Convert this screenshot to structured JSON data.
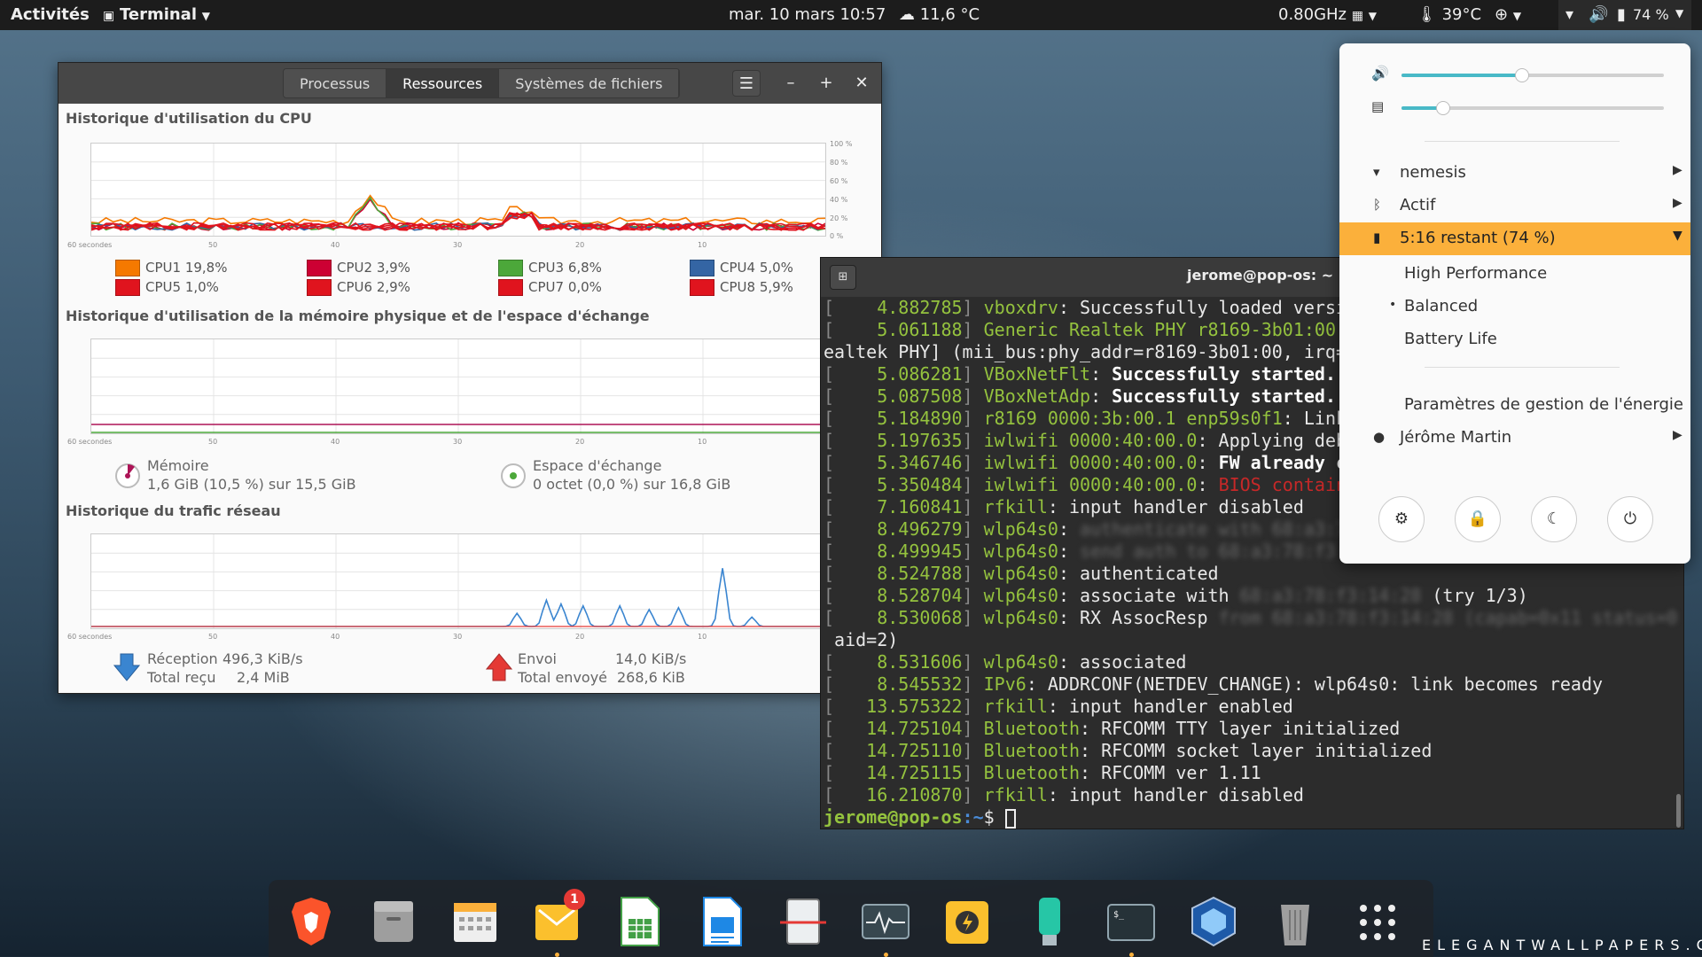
{
  "topbar": {
    "activities": "Activités",
    "app_name": "Terminal",
    "clock": "mar. 10 mars  10:57",
    "weather": "11,6 °C",
    "cpu_freq": "0.80GHz",
    "temperature": "39°C",
    "battery": "74 %"
  },
  "sysmon": {
    "tabs": [
      "Processus",
      "Ressources",
      "Systèmes de fichiers"
    ],
    "active_tab": "Ressources",
    "cpu_title": "Historique d'utilisation du CPU",
    "mem_title": "Historique d'utilisation de la mémoire physique et de l'espace d'échange",
    "net_title": "Historique du trafic réseau",
    "x_ticks": [
      "60 secondes",
      "50",
      "40",
      "30",
      "20",
      "10"
    ],
    "y_ticks": [
      "100 %",
      "80 %",
      "60 %",
      "40 %",
      "20 %",
      "0 %"
    ],
    "cpu_legend": [
      {
        "label": "CPU1",
        "value": "19,8%",
        "color": "#f57900"
      },
      {
        "label": "CPU2",
        "value": "3,9%",
        "color": "#cc0033"
      },
      {
        "label": "CPU3",
        "value": "6,8%",
        "color": "#4ca83a"
      },
      {
        "label": "CPU4",
        "value": "5,0%",
        "color": "#3465a4"
      },
      {
        "label": "CPU5",
        "value": "1,0%",
        "color": "#e0141e"
      },
      {
        "label": "CPU6",
        "value": "2,9%",
        "color": "#e0141e"
      },
      {
        "label": "CPU7",
        "value": "0,0%",
        "color": "#e0141e"
      },
      {
        "label": "CPU8",
        "value": "5,9%",
        "color": "#e0141e"
      }
    ],
    "memory": {
      "label": "Mémoire",
      "value": "1,6 GiB (10,5 %) sur 15,5 GiB",
      "fraction": 0.105
    },
    "swap": {
      "label": "Espace d'échange",
      "value": "0 octet (0,0 %) sur 16,8 GiB",
      "fraction": 0.0
    },
    "network": {
      "receive_label": "Réception",
      "receive_rate": "496,3 KiB/s",
      "total_received_label": "Total reçu",
      "total_received": "2,4 MiB",
      "send_label": "Envoi",
      "send_rate": "14,0 KiB/s",
      "total_sent_label": "Total envoyé",
      "total_sent": "268,6 KiB"
    }
  },
  "terminal": {
    "title": "jerome@pop-os: ~",
    "lines": [
      [
        [
          "br",
          "["
        ],
        [
          "num",
          "    4.882785"
        ],
        [
          "br",
          "] "
        ],
        [
          "num",
          "vboxdrv"
        ],
        [
          "t",
          ": Successfully loaded versi"
        ]
      ],
      [
        [
          "br",
          "["
        ],
        [
          "num",
          "    5.061188"
        ],
        [
          "br",
          "] "
        ],
        [
          "num",
          "Generic Realtek PHY r8169-3b01:00"
        ],
        [
          "t",
          ":"
        ]
      ],
      [
        [
          "t",
          "ealtek PHY] (mii_bus:phy_addr=r8169-3b01:00, irq="
        ]
      ],
      [
        [
          "br",
          "["
        ],
        [
          "num",
          "    5.086281"
        ],
        [
          "br",
          "] "
        ],
        [
          "num",
          "VBoxNetFlt"
        ],
        [
          "t",
          ": "
        ],
        [
          "b",
          "Successfully started."
        ]
      ],
      [
        [
          "br",
          "["
        ],
        [
          "num",
          "    5.087508"
        ],
        [
          "br",
          "] "
        ],
        [
          "num",
          "VBoxNetAdp"
        ],
        [
          "t",
          ": "
        ],
        [
          "b",
          "Successfully started."
        ]
      ],
      [
        [
          "br",
          "["
        ],
        [
          "num",
          "    5.184890"
        ],
        [
          "br",
          "] "
        ],
        [
          "num",
          "r8169 0000:3b:00.1 enp59s0f1"
        ],
        [
          "t",
          ": Link"
        ]
      ],
      [
        [
          "br",
          "["
        ],
        [
          "num",
          "    5.197635"
        ],
        [
          "br",
          "] "
        ],
        [
          "num",
          "iwlwifi 0000:40:00.0"
        ],
        [
          "t",
          ": Applying deb"
        ]
      ],
      [
        [
          "br",
          "["
        ],
        [
          "num",
          "    5.346746"
        ],
        [
          "br",
          "] "
        ],
        [
          "num",
          "iwlwifi 0000:40:00.0"
        ],
        [
          "t",
          ": "
        ],
        [
          "b",
          "FW already c"
        ]
      ],
      [
        [
          "br",
          "["
        ],
        [
          "num",
          "    5.350484"
        ],
        [
          "br",
          "] "
        ],
        [
          "num",
          "iwlwifi 0000:40:00.0"
        ],
        [
          "t",
          ": "
        ],
        [
          "red",
          "BIOS contain"
        ]
      ],
      [
        [
          "br",
          "["
        ],
        [
          "num",
          "    7.160841"
        ],
        [
          "br",
          "] "
        ],
        [
          "num",
          "rfkill"
        ],
        [
          "t",
          ": input handler disabled"
        ]
      ],
      [
        [
          "br",
          "["
        ],
        [
          "num",
          "    8.496279"
        ],
        [
          "br",
          "] "
        ],
        [
          "num",
          "wlp64s0"
        ],
        [
          "t",
          ": "
        ],
        [
          "blur",
          "authenticate with 68:a3:7"
        ]
      ],
      [
        [
          "br",
          "["
        ],
        [
          "num",
          "    8.499945"
        ],
        [
          "br",
          "] "
        ],
        [
          "num",
          "wlp64s0"
        ],
        [
          "t",
          ": "
        ],
        [
          "blur",
          "send auth to 68:a3:78:f3"
        ]
      ],
      [
        [
          "br",
          "["
        ],
        [
          "num",
          "    8.524788"
        ],
        [
          "br",
          "] "
        ],
        [
          "num",
          "wlp64s0"
        ],
        [
          "t",
          ": authenticated"
        ]
      ],
      [
        [
          "br",
          "["
        ],
        [
          "num",
          "    8.528704"
        ],
        [
          "br",
          "] "
        ],
        [
          "num",
          "wlp64s0"
        ],
        [
          "t",
          ": associate with "
        ],
        [
          "blur",
          "68:a3:78:f3:14:28"
        ],
        [
          "t",
          " (try 1/3)"
        ]
      ],
      [
        [
          "br",
          "["
        ],
        [
          "num",
          "    8.530068"
        ],
        [
          "br",
          "] "
        ],
        [
          "num",
          "wlp64s0"
        ],
        [
          "t",
          ": RX AssocResp "
        ],
        [
          "blur",
          "from 68:a3:78:f3:14:28 (capab=0x11 status=0"
        ]
      ],
      [
        [
          "t",
          " aid=2)"
        ]
      ],
      [
        [
          "br",
          "["
        ],
        [
          "num",
          "    8.531606"
        ],
        [
          "br",
          "] "
        ],
        [
          "num",
          "wlp64s0"
        ],
        [
          "t",
          ": associated"
        ]
      ],
      [
        [
          "br",
          "["
        ],
        [
          "num",
          "    8.545532"
        ],
        [
          "br",
          "] "
        ],
        [
          "num",
          "IPv6"
        ],
        [
          "t",
          ": ADDRCONF(NETDEV_CHANGE): wlp64s0: link becomes ready"
        ]
      ],
      [
        [
          "br",
          "["
        ],
        [
          "num",
          "   13.575322"
        ],
        [
          "br",
          "] "
        ],
        [
          "num",
          "rfkill"
        ],
        [
          "t",
          ": input handler enabled"
        ]
      ],
      [
        [
          "br",
          "["
        ],
        [
          "num",
          "   14.725104"
        ],
        [
          "br",
          "] "
        ],
        [
          "num",
          "Bluetooth"
        ],
        [
          "t",
          ": RFCOMM TTY layer initialized"
        ]
      ],
      [
        [
          "br",
          "["
        ],
        [
          "num",
          "   14.725110"
        ],
        [
          "br",
          "] "
        ],
        [
          "num",
          "Bluetooth"
        ],
        [
          "t",
          ": RFCOMM socket layer initialized"
        ]
      ],
      [
        [
          "br",
          "["
        ],
        [
          "num",
          "   14.725115"
        ],
        [
          "br",
          "] "
        ],
        [
          "num",
          "Bluetooth"
        ],
        [
          "t",
          ": RFCOMM ver 1.11"
        ]
      ],
      [
        [
          "br",
          "["
        ],
        [
          "num",
          "   16.210870"
        ],
        [
          "br",
          "] "
        ],
        [
          "num",
          "rfkill"
        ],
        [
          "t",
          ": input handler disabled"
        ]
      ]
    ],
    "prompt_user": "jerome@pop-os",
    "prompt_path": ":~",
    "prompt_symbol": "$ "
  },
  "panel": {
    "volume_level": 0.46,
    "brightness_level": 0.16,
    "wifi_label": "nemesis",
    "bluetooth_label": "Actif",
    "battery_label": "5:16 restant (74 %)",
    "power_modes": [
      "High Performance",
      "Balanced",
      "Battery Life"
    ],
    "active_power_mode": "Balanced",
    "power_settings": "Paramètres de gestion de l'énergie",
    "user_name": "Jérôme Martin",
    "accent": "#fbb03b"
  },
  "dock": {
    "apps": [
      "brave-icon",
      "files-icon",
      "calendar-icon",
      "mail-icon",
      "spreadsheet-icon",
      "writer-icon",
      "screenshot-icon",
      "system-monitor-icon",
      "power-icon",
      "usb-icon",
      "terminal-icon",
      "virtualbox-icon",
      "trash-icon",
      "app-grid-icon"
    ],
    "mail_badge": "1"
  },
  "watermark": "ELEGANTWALLPAPERS.COM"
}
